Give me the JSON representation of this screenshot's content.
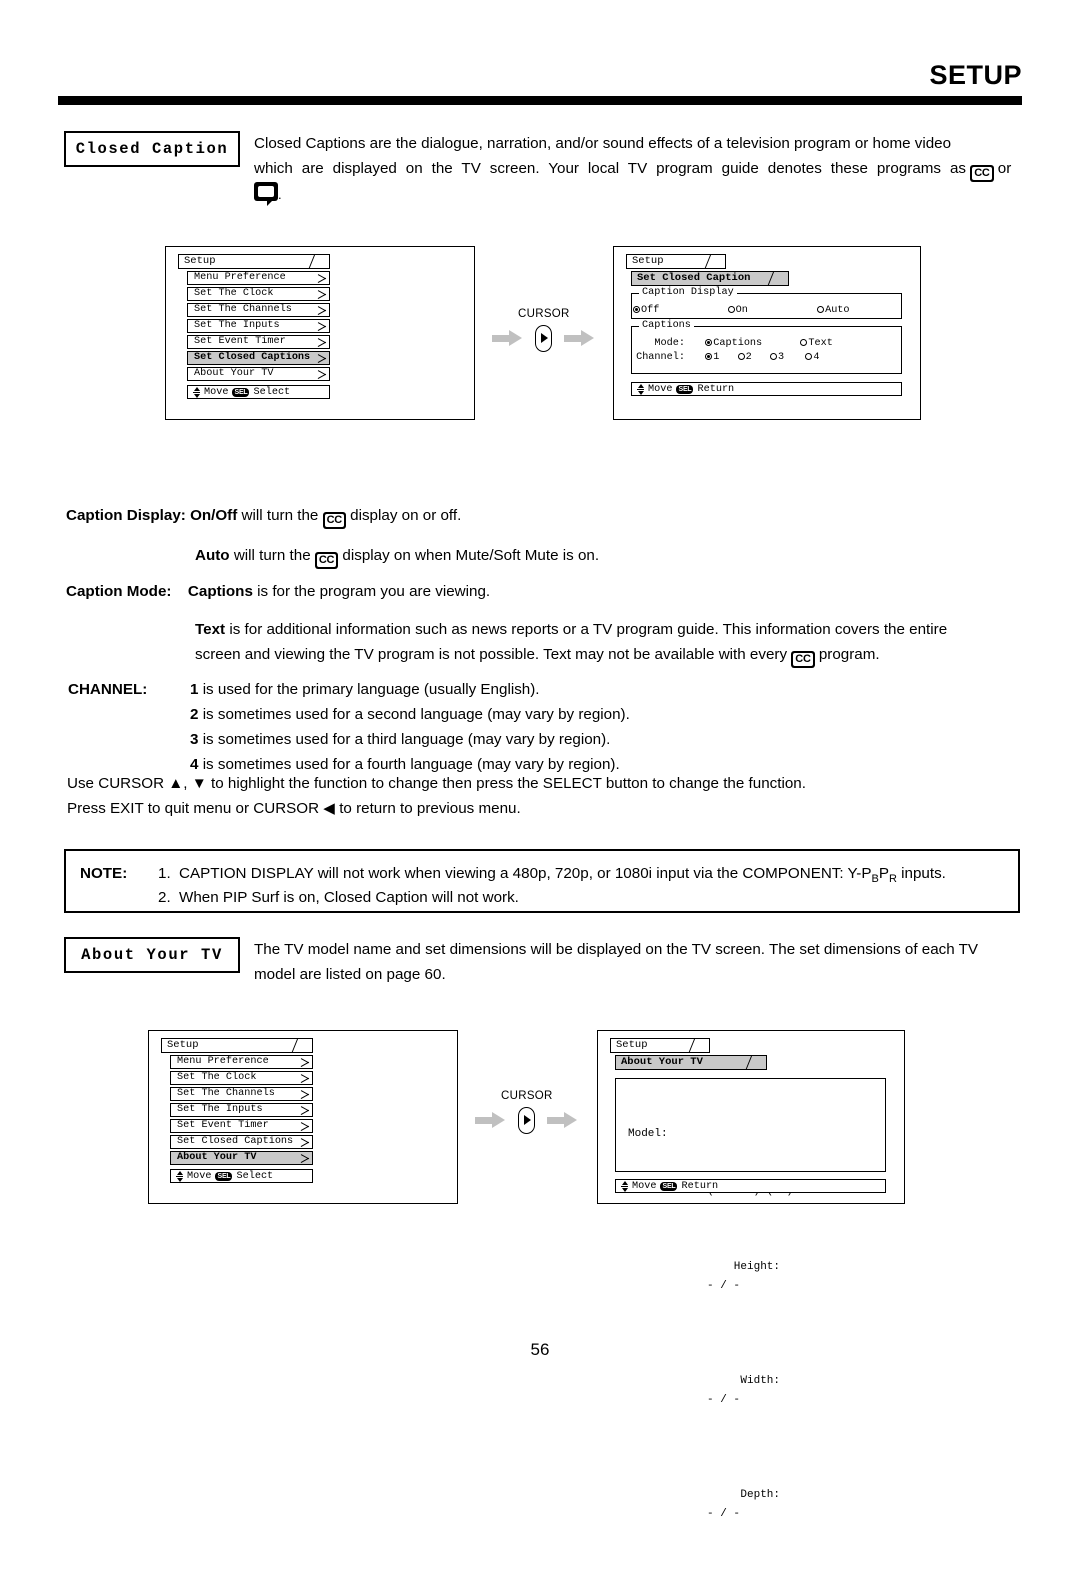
{
  "header": {
    "title": "SETUP"
  },
  "sections": {
    "closed_caption": {
      "label": "Closed Caption",
      "body_line1": "Closed Captions are the dialogue, narration, and/or sound effects of a television program or home video",
      "body_line2a": "which are displayed on the TV screen.  Your local TV program guide denotes these programs as",
      "body_line2b": "or",
      "body_line3": "."
    },
    "about_your_tv": {
      "label": "About Your TV",
      "body_line1": "The TV model name and set dimensions will be displayed on the TV screen.  The set dimensions of each TV",
      "body_line2": "model are listed on page 60."
    }
  },
  "descriptions": {
    "caption_display_label": "Caption Display:",
    "caption_display_onoff_bold": "On/Off",
    "caption_display_onoff_text": "will turn the",
    "caption_display_onoff_tail": "display on or off.",
    "caption_display_auto_bold": "Auto",
    "caption_display_auto_text": "will turn the",
    "caption_display_auto_tail": "display on when Mute/Soft Mute is on.",
    "caption_mode_label": "Caption Mode:",
    "caption_mode_captions_bold": "Captions",
    "caption_mode_captions_text": "is for the program you are viewing.",
    "caption_mode_text_bold": "Text",
    "caption_mode_text_line1": "is for additional information such as news reports or a TV program guide.  This information covers the entire",
    "caption_mode_text_line2a": "screen and viewing the TV program is not possible.  Text may not be available with every",
    "caption_mode_text_line2b": "program.",
    "channel_label": "CHANNEL:",
    "channel_items": [
      {
        "num": "1",
        "text": "is used for the primary language (usually English)."
      },
      {
        "num": "2",
        "text": "is sometimes used for a second language (may vary by region)."
      },
      {
        "num": "3",
        "text": "is sometimes used for a third language (may vary by region)."
      },
      {
        "num": "4",
        "text": "is sometimes used for a fourth language (may vary by region)."
      }
    ],
    "instruction_line1": "Use CURSOR ▲, ▼ to highlight the function to change then press the SELECT button to change the function.",
    "instruction_line2": "Press EXIT to quit menu or CURSOR ◀ to return to previous menu."
  },
  "note": {
    "label": "NOTE:",
    "item1_num": "1.",
    "item1_pre": "CAPTION DISPLAY will not work when viewing a 480p, 720p, or 1080i input via the COMPONENT: Y-P",
    "item1_sub1": "B",
    "item1_mid": "P",
    "item1_sub2": "R",
    "item1_post": "inputs.",
    "item2_num": "2.",
    "item2_text": "When PIP Surf is on, Closed Caption will not work."
  },
  "cursor": {
    "label": "CURSOR",
    "button_icon": "triangle-right-icon",
    "flow_arrow_icon": "arrow-right-icon"
  },
  "osd": {
    "tab_setup": "Setup",
    "setup_menu_items": [
      "Menu Preference",
      "Set The Clock",
      "Set The Channels",
      "Set The Inputs",
      "Set Event Timer",
      "Set Closed Captions",
      "About Your TV"
    ],
    "footer_move": "Move",
    "footer_sel": "SEL",
    "footer_select": "Select",
    "footer_return": "Return",
    "closed_caption_screen": {
      "tab_title": "Set Closed Caption",
      "group_caption_display": "Caption Display",
      "caption_display_options": [
        {
          "label": "Off",
          "selected": true
        },
        {
          "label": "On",
          "selected": false
        },
        {
          "label": "Auto",
          "selected": false
        }
      ],
      "group_captions": "Captions",
      "mode_label": "Mode:",
      "mode_options": [
        {
          "label": "Captions",
          "selected": true
        },
        {
          "label": "Text",
          "selected": false
        }
      ],
      "channel_label": "Channel:",
      "channel_options": [
        {
          "label": "1",
          "selected": true
        },
        {
          "label": "2",
          "selected": false
        },
        {
          "label": "3",
          "selected": false
        },
        {
          "label": "4",
          "selected": false
        }
      ]
    },
    "about_screen": {
      "tab_title": "About Your TV",
      "model_label": "Model:",
      "dimensions_header": "Dimensions  (Inches) (mm)",
      "rows": [
        {
          "label": "Height:",
          "value": "- / -"
        },
        {
          "label": "Width:",
          "value": "- / -"
        },
        {
          "label": "Depth:",
          "value": "- / -"
        }
      ]
    }
  },
  "footer": {
    "page_number": "56"
  }
}
